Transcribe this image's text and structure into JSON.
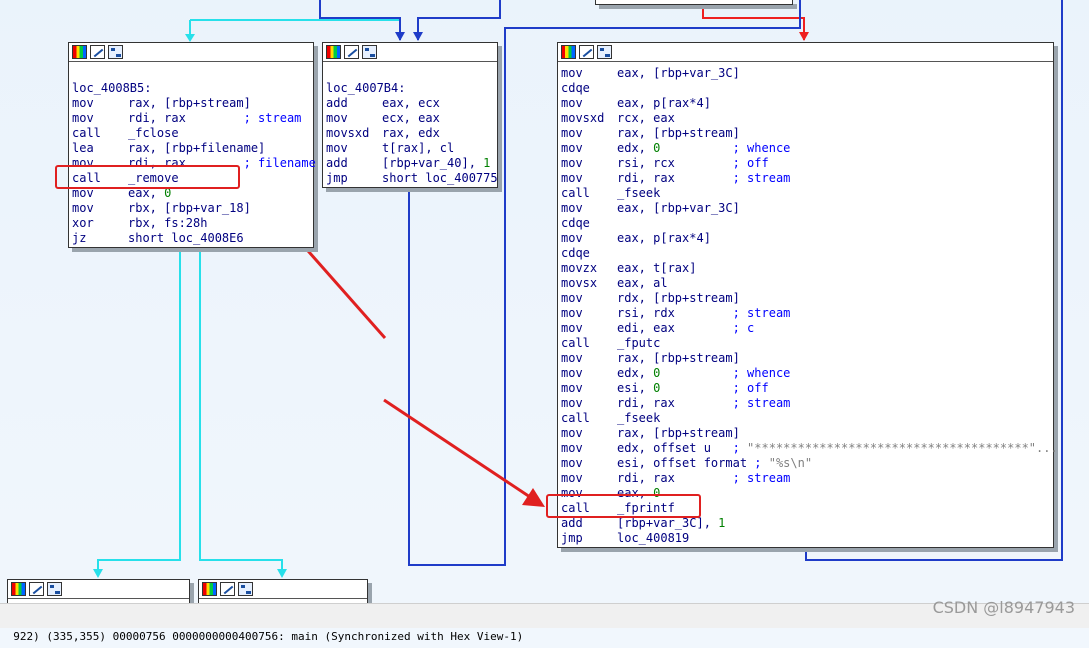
{
  "blocks": [
    {
      "id": "loc_4008B5",
      "lines": [
        {
          "t": ""
        },
        {
          "t": "loc_4008B5:"
        },
        {
          "m": "mov",
          "o": "rax, [rbp+stream]"
        },
        {
          "m": "mov",
          "o": "rdi, rax        ",
          "c": "; stream"
        },
        {
          "m": "call",
          "o": "_fclose"
        },
        {
          "m": "lea",
          "o": "rax, [rbp+filename]"
        },
        {
          "m": "mov",
          "o": "rdi, rax        ",
          "c": "; filename"
        },
        {
          "m": "call",
          "o": "_remove"
        },
        {
          "m": "mov",
          "o": "eax, ",
          "n": "0"
        },
        {
          "m": "mov",
          "o": "rbx, [rbp+var_18]"
        },
        {
          "m": "xor",
          "o": "rbx, fs:28h"
        },
        {
          "m": "jz",
          "o": "short loc_4008E6"
        }
      ]
    },
    {
      "id": "loc_4007B4",
      "lines": [
        {
          "t": ""
        },
        {
          "t": "loc_4007B4:"
        },
        {
          "m": "add",
          "o": "eax, ecx"
        },
        {
          "m": "mov",
          "o": "ecx, eax"
        },
        {
          "m": "movsxd",
          "o": "rax, edx"
        },
        {
          "m": "mov",
          "o": "t[rax], cl"
        },
        {
          "m": "add",
          "o": "[rbp+var_40], ",
          "n": "1"
        },
        {
          "m": "jmp",
          "o": "short loc_400775"
        }
      ]
    },
    {
      "id": "main_block",
      "lines": [
        {
          "m": "mov",
          "o": "eax, [rbp+var_3C]"
        },
        {
          "m": "cdqe",
          "o": ""
        },
        {
          "m": "mov",
          "o": "eax, p[rax*4]"
        },
        {
          "m": "movsxd",
          "o": "rcx, eax"
        },
        {
          "m": "mov",
          "o": "rax, [rbp+stream]"
        },
        {
          "m": "mov",
          "o": "edx, ",
          "n": "0",
          "pad": "          ",
          "c": "; whence"
        },
        {
          "m": "mov",
          "o": "rsi, rcx        ",
          "c": "; off"
        },
        {
          "m": "mov",
          "o": "rdi, rax        ",
          "c": "; stream"
        },
        {
          "m": "call",
          "o": "_fseek"
        },
        {
          "m": "mov",
          "o": "eax, [rbp+var_3C]"
        },
        {
          "m": "cdqe",
          "o": ""
        },
        {
          "m": "mov",
          "o": "eax, p[rax*4]"
        },
        {
          "m": "cdqe",
          "o": ""
        },
        {
          "m": "movzx",
          "o": "eax, t[rax]"
        },
        {
          "m": "movsx",
          "o": "eax, al"
        },
        {
          "m": "mov",
          "o": "rdx, [rbp+stream]"
        },
        {
          "m": "mov",
          "o": "rsi, rdx        ",
          "c": "; stream"
        },
        {
          "m": "mov",
          "o": "edi, eax        ",
          "c": "; c"
        },
        {
          "m": "call",
          "o": "_fputc"
        },
        {
          "m": "mov",
          "o": "rax, [rbp+stream]"
        },
        {
          "m": "mov",
          "o": "edx, ",
          "n": "0",
          "pad": "          ",
          "c": "; whence"
        },
        {
          "m": "mov",
          "o": "esi, ",
          "n": "0",
          "pad": "          ",
          "c": "; off"
        },
        {
          "m": "mov",
          "o": "rdi, rax        ",
          "c": "; stream"
        },
        {
          "m": "call",
          "o": "_fseek"
        },
        {
          "m": "mov",
          "o": "rax, [rbp+stream]"
        },
        {
          "m": "mov",
          "o": "edx, offset u   ",
          "c": "; ",
          "s": "\"**************************************\"..."
        },
        {
          "m": "mov",
          "o": "esi, offset format ",
          "c": "; ",
          "s": "\"%s\\n\""
        },
        {
          "m": "mov",
          "o": "rdi, rax        ",
          "c": "; stream"
        },
        {
          "m": "mov",
          "o": "eax, ",
          "n": "0"
        },
        {
          "m": "call",
          "o": "_fprintf"
        },
        {
          "m": "add",
          "o": "[rbp+var_3C], ",
          "n": "1"
        },
        {
          "m": "jmp",
          "o": "loc_400819"
        }
      ]
    }
  ],
  "status_bar": {
    "text": "922) (335,355) 00000756 0000000000400756: main (Synchronized with Hex View-1)"
  },
  "watermark": "CSDN @l8947943",
  "colors": {
    "edge_blue": "#1f3cc8",
    "edge_cyan": "#27e0ea",
    "edge_red": "#ee2020",
    "annotation_red": "#e02020"
  }
}
